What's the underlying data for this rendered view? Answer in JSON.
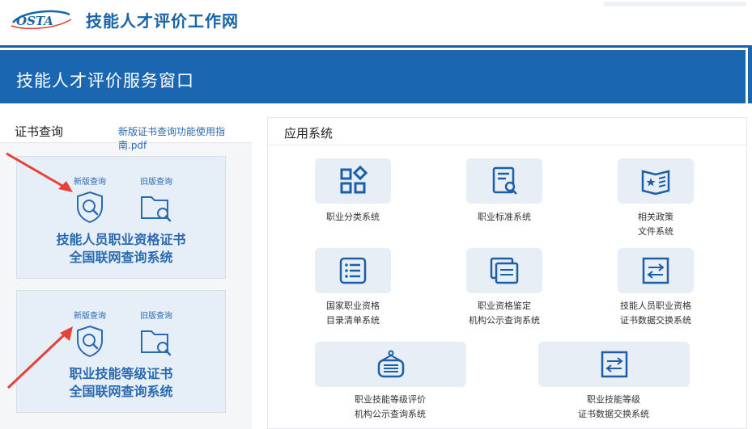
{
  "header": {
    "logo_text": "OSTA",
    "site_title": "技能人才评价工作网"
  },
  "banner": {
    "title": "技能人才评价服务窗口"
  },
  "certificate_query": {
    "title": "证书查询",
    "guide_link": "新版证书查询功能使用指南.pdf",
    "cards": [
      {
        "new_label": "新版查询",
        "old_label": "旧版查询",
        "line1": "技能人员职业资格证书",
        "line2": "全国联网查询系统"
      },
      {
        "new_label": "新版查询",
        "old_label": "旧版查询",
        "line1": "职业技能等级证书",
        "line2": "全国联网查询系统"
      }
    ]
  },
  "applications": {
    "title": "应用系统",
    "items": [
      {
        "line1": "职业分类系统",
        "line2": "",
        "icon": "grid-diamond-icon"
      },
      {
        "line1": "职业标准系统",
        "line2": "",
        "icon": "document-search-icon"
      },
      {
        "line1": "相关政策",
        "line2": "文件系统",
        "icon": "policy-book-icon"
      },
      {
        "line1": "国家职业资格",
        "line2": "目录清单系统",
        "icon": "list-icon"
      },
      {
        "line1": "职业资格鉴定",
        "line2": "机构公示查询系统",
        "icon": "stacked-docs-icon"
      },
      {
        "line1": "技能人员职业资格",
        "line2": "证书数据交换系统",
        "icon": "exchange-icon"
      },
      {
        "line1": "职业技能等级评价",
        "line2": "机构公示查询系统",
        "icon": "notice-board-icon"
      },
      {
        "line1": "职业技能等级",
        "line2": "证书数据交换系统",
        "icon": "exchange-icon"
      }
    ]
  },
  "colors": {
    "brand_blue": "#1a66b0",
    "link_blue": "#2a6ab0",
    "card_bg": "#e6eef7",
    "arrow_red": "#e8413a"
  }
}
